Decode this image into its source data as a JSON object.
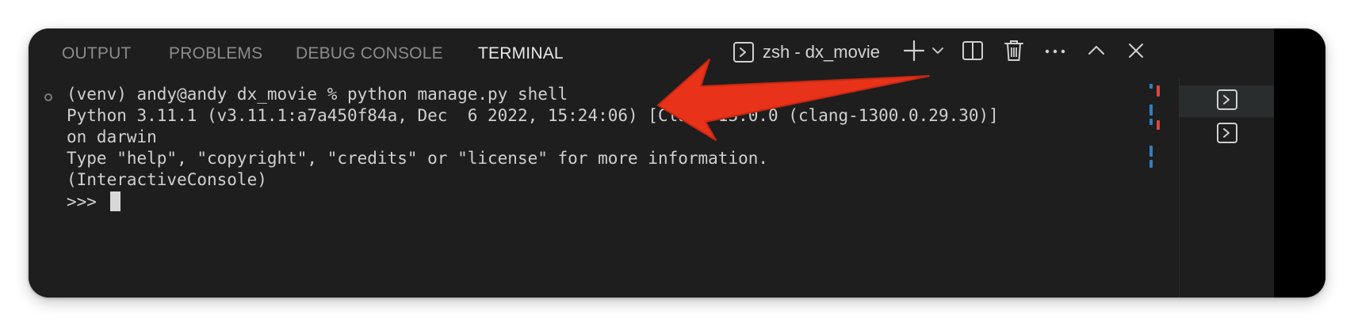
{
  "panel": {
    "tabs": [
      {
        "label": "OUTPUT",
        "active": false
      },
      {
        "label": "PROBLEMS",
        "active": false
      },
      {
        "label": "DEBUG CONSOLE",
        "active": false
      },
      {
        "label": "TERMINAL",
        "active": true
      }
    ],
    "terminal_name": "zsh - dx_movie",
    "toolbar_icons": [
      "terminal-icon",
      "plus-icon",
      "chevron-down-icon",
      "split-icon",
      "trash-icon",
      "ellipsis-icon",
      "chevron-up-icon",
      "close-icon"
    ]
  },
  "terminal": {
    "lines": [
      "(venv) andy@andy dx_movie % python manage.py shell",
      "Python 3.11.1 (v3.11.1:a7a450f84a, Dec  6 2022, 15:24:06) [Clang 13.0.0 (clang-1300.0.29.30)]",
      "on darwin",
      "Type \"help\", \"copyright\", \"credits\" or \"license\" for more information.",
      "(InteractiveConsole)",
      ">>> "
    ]
  },
  "side_terminals": [
    {
      "icon": "terminal-icon",
      "selected": true
    },
    {
      "icon": "terminal-icon",
      "selected": false
    }
  ],
  "colors": {
    "panel_bg": "#1e1e1e",
    "text": "#d0d0d0",
    "tab_inactive": "#8b8b8b",
    "tab_active": "#e7e7e7",
    "annotation_arrow": "#e8321a",
    "marker_blue": "#2f7fc6",
    "marker_red": "#e0463a"
  }
}
